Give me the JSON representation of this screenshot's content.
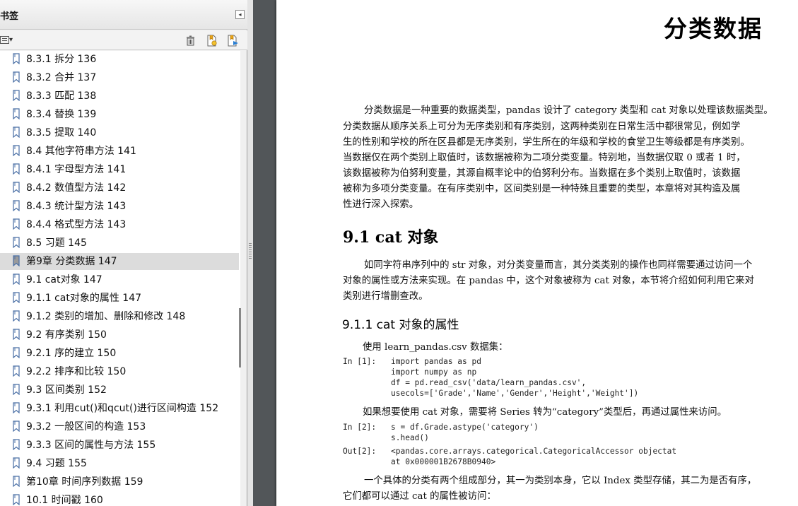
{
  "panel": {
    "title": "书签",
    "collapse_glyph": "◂",
    "options_glyph": "▾"
  },
  "bookmarks": [
    {
      "label": "8.3.1 拆分    136"
    },
    {
      "label": "8.3.2 合并    137"
    },
    {
      "label": "8.3.3 匹配    138"
    },
    {
      "label": "8.3.4 替换    139"
    },
    {
      "label": "8.3.5 提取    140"
    },
    {
      "label": "8.4 其他字符串方法    141"
    },
    {
      "label": "8.4.1 字母型方法    141"
    },
    {
      "label": "8.4.2 数值型方法    142"
    },
    {
      "label": "8.4.3 统计型方法    143"
    },
    {
      "label": "8.4.4 格式型方法    143"
    },
    {
      "label": "8.5 习题    145"
    },
    {
      "label": "第9章 分类数据    147",
      "selected": true
    },
    {
      "label": "9.1 cat对象    147"
    },
    {
      "label": "9.1.1 cat对象的属性    147"
    },
    {
      "label": "9.1.2 类别的增加、删除和修改    148"
    },
    {
      "label": "9.2 有序类别    150"
    },
    {
      "label": "9.2.1 序的建立    150"
    },
    {
      "label": "9.2.2 排序和比较    150"
    },
    {
      "label": "9.3 区间类别    152"
    },
    {
      "label": "9.3.1 利用cut()和qcut()进行区间构造    152"
    },
    {
      "label": "9.3.2 一般区间的构造    153"
    },
    {
      "label": "9.3.3 区间的属性与方法    155"
    },
    {
      "label": "9.4 习题    155"
    },
    {
      "label": "第10章 时间序列数据    159"
    },
    {
      "label": "10.1 时间戳    160"
    }
  ],
  "document": {
    "chapter_title": "分类数据",
    "intro_lines": [
      "分类数据是一种重要的数据类型，pandas 设计了 category 类型和 cat 对象以处理该数据类型。",
      "分类数据从顺序关系上可分为无序类别和有序类别，这两种类别在日常生活中都很常见，例如学",
      "生的性别和学校的所在区县都是无序类别，学生所在的年级和学校的食堂卫生等级都是有序类别。",
      "当数据仅在两个类别上取值时，该数据被称为二项分类变量。特别地，当数据仅取 0 或者 1 时，",
      "该数据被称为伯努利变量，其源自概率论中的伯努利分布。当数据在多个类别上取值时，该数据",
      "被称为多项分类变量。在有序类别中，区间类别是一种特殊且重要的类型，本章将对其构造及属",
      "性进行深入探索。"
    ],
    "section_9_1": "9.1   cat 对象",
    "section_9_1_lines": [
      "如同字符串序列中的 str 对象，对分类变量而言，其分类类别的操作也同样需要通过访问一个",
      "对象的属性或方法来实现。在 pandas 中，这个对象被称为 cat 对象，本节将介绍如何利用它来对",
      "类别进行增删查改。"
    ],
    "section_9_1_1": "9.1.1   cat 对象的属性",
    "dataset_line": "使用 learn_pandas.csv 数据集：",
    "code1_prompt": "In [1]:",
    "code1_lines": [
      "import pandas as pd",
      "import numpy as np",
      "df = pd.read_csv('data/learn_pandas.csv',",
      "    usecols=['Grade','Name','Gender','Height','Weight'])"
    ],
    "convert_line": "如果想要使用 cat 对象，需要将 Series 转为“category”类型后，再通过属性来访问。",
    "code2_prompt": "In [2]:",
    "code2_lines": [
      "s = df.Grade.astype('category')",
      "s.head()"
    ],
    "out2_prompt": "Out[2]:",
    "out2_lines": [
      "<pandas.core.arrays.categorical.CategoricalAccessor objectat",
      " at 0x000001B2678B0940>"
    ],
    "final_lines": [
      "一个具体的分类有两个组成部分，其一为类别本身，它以 Index 类型存储，其二为是否有序，",
      "它们都可以通过 cat 的属性被访问："
    ]
  }
}
